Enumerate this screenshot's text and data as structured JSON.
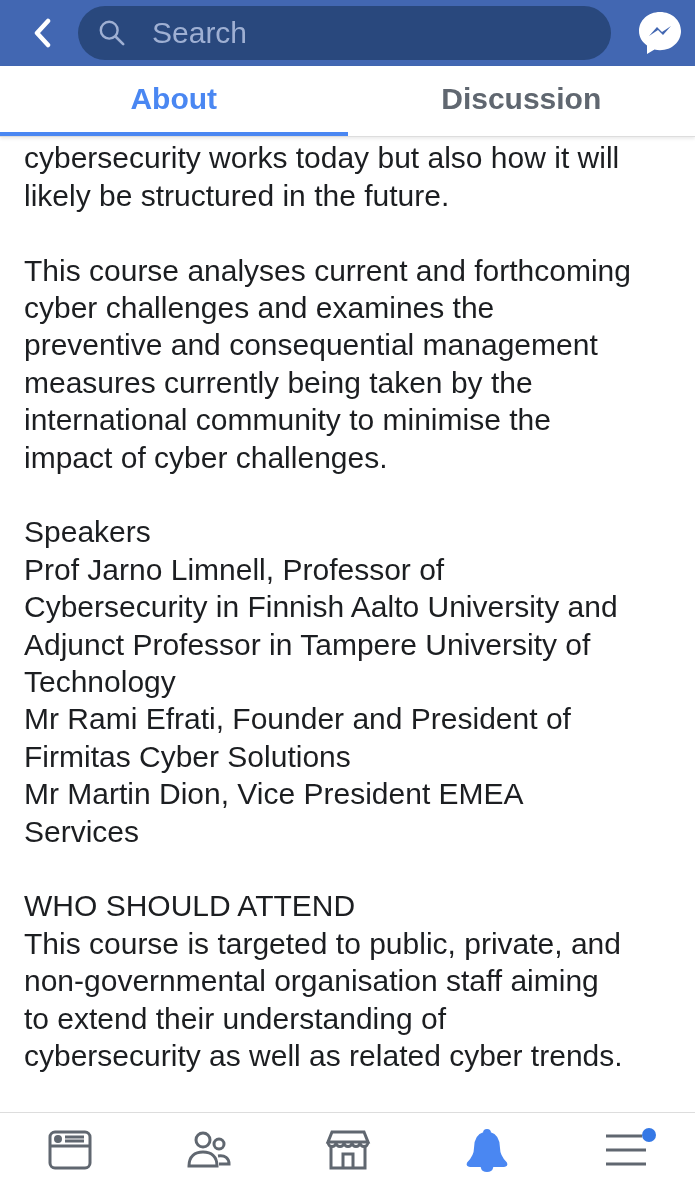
{
  "header": {
    "search": {
      "placeholder": "Search"
    }
  },
  "tabs": [
    {
      "label": "About",
      "selected": true
    },
    {
      "label": "Discussion",
      "selected": false
    }
  ],
  "content": [
    {
      "kind": "paragraph",
      "lines": [
        "cybersecurity works today but also how it will",
        "likely be structured in the future."
      ]
    },
    {
      "kind": "paragraph",
      "lines": [
        "This course analyses current and forthcoming",
        "cyber challenges and examines the",
        "preventive and consequential management",
        "measures currently being taken by the",
        "international community to minimise the",
        "impact of cyber challenges."
      ]
    },
    {
      "kind": "heading",
      "lines": [
        "Speakers"
      ]
    },
    {
      "kind": "speaker",
      "lines": [
        "Prof Jarno Limnell, Professor of",
        "Cybersecurity in Finnish Aalto University and",
        "Adjunct Professor in Tampere University of",
        "Technology"
      ]
    },
    {
      "kind": "speaker",
      "lines": [
        "Mr Rami Efrati, Founder and President of",
        "Firmitas Cyber Solutions"
      ]
    },
    {
      "kind": "speaker",
      "lines": [
        "Mr Martin Dion, Vice President EMEA",
        "Services"
      ]
    },
    {
      "kind": "section-heading",
      "lines": [
        "WHO SHOULD ATTEND"
      ]
    },
    {
      "kind": "paragraph",
      "lines": [
        "This course is targeted to public, private, and",
        "non-governmental organisation staff aiming",
        "to extend their understanding of",
        "cybersecurity as well as related cyber trends."
      ]
    }
  ],
  "nav": [
    {
      "kind": "news",
      "selected": false,
      "badge": false
    },
    {
      "kind": "friends",
      "selected": false,
      "badge": false
    },
    {
      "kind": "marketplace",
      "selected": false,
      "badge": false
    },
    {
      "kind": "notifications",
      "selected": true,
      "badge": false
    },
    {
      "kind": "menu",
      "selected": false,
      "badge": true
    }
  ]
}
